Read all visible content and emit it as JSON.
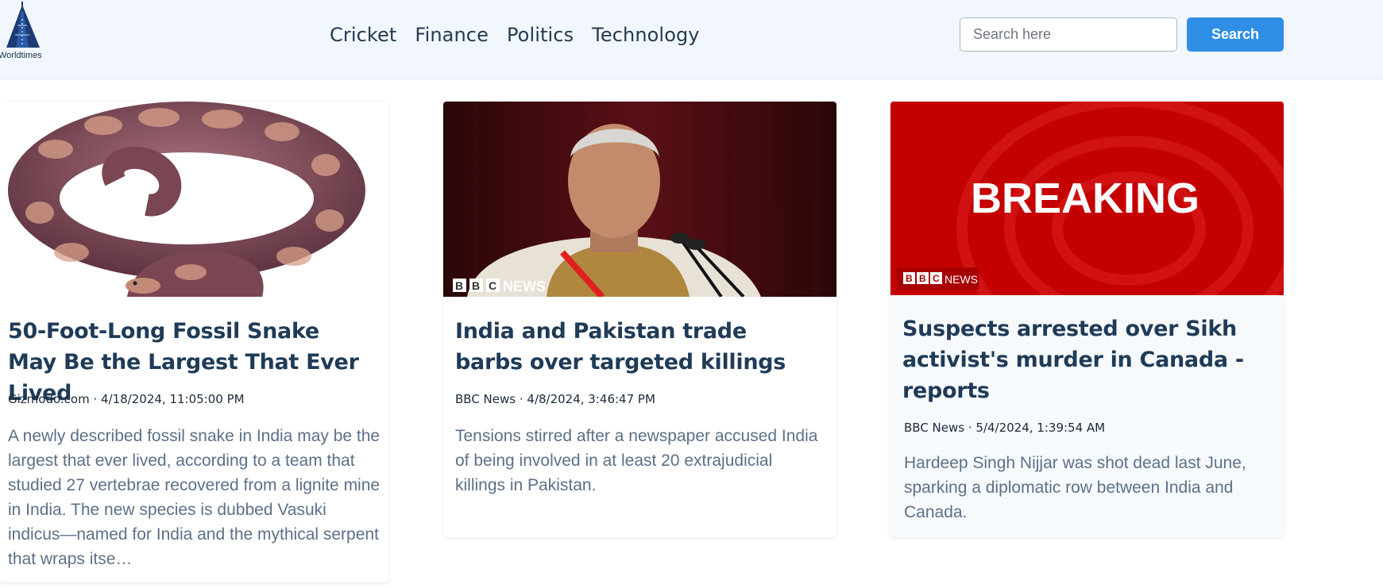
{
  "brand": {
    "name": "Worldtimes"
  },
  "nav": {
    "links": [
      "Cricket",
      "Finance",
      "Politics",
      "Technology"
    ]
  },
  "search": {
    "placeholder": "Search here",
    "value": "",
    "button_label": "Search"
  },
  "colors": {
    "accent": "#2f8fe6",
    "title": "#1f3b57",
    "desc": "#5c7088",
    "breaking_red": "#c40000"
  },
  "articles": [
    {
      "title": "50-Foot-Long Fossil Snake May Be the Largest That Ever Lived",
      "meta": "Gizmodo.com · 4/18/2024, 11:05:00 PM",
      "description": "A newly described fossil snake in India may be the largest that ever lived, according to a team that studied 27 vertebrae recovered from a lignite mine in India. The new species is dubbed Vasuki indicus—named for India and the mythical serpent that wraps itse…",
      "image": "fossil-snake-illustration"
    },
    {
      "title": "India and Pakistan trade barbs over targeted killings",
      "meta": "BBC News · 4/8/2024, 3:46:47 PM",
      "description": "Tensions stirred after a newspaper accused India of being involved in at least 20 extrajudicial killings in Pakistan.",
      "image": "speaker-at-microphone-photo",
      "image_watermark": "NEWS"
    },
    {
      "title": "Suspects arrested over Sikh activist's murder in Canada - reports",
      "meta": "BBC News · 5/4/2024, 1:39:54 AM",
      "description": "Hardeep Singh Nijjar was shot dead last June, sparking a diplomatic row between India and Canada.",
      "image": "breaking-news-banner",
      "image_text": "BREAKING",
      "image_watermark": "NEWS"
    }
  ]
}
